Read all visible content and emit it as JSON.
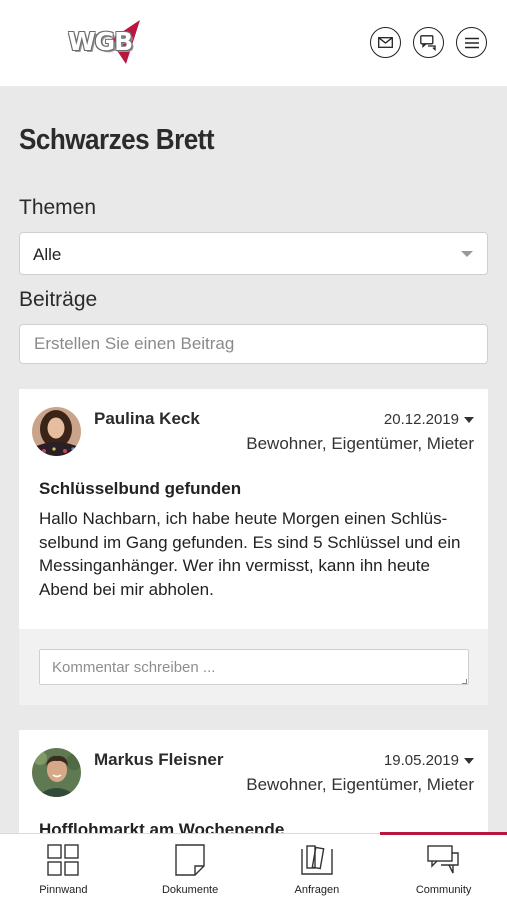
{
  "header": {
    "logo_text": "WGB",
    "brand_color": "#b8153f",
    "icons": [
      "mail-icon",
      "chat-icon",
      "menu-icon"
    ]
  },
  "page": {
    "title": "Schwarzes Brett",
    "topics_label": "Themen",
    "topics_select": {
      "selected": "Alle"
    },
    "posts_label": "Beiträge",
    "create_placeholder": "Erstellen Sie einen Beitrag"
  },
  "posts": [
    {
      "author": "Paulina Keck",
      "date": "20.12.2019",
      "roles": "Bewohner, Eigentümer, Mieter",
      "title": "Schlüsselbund gefunden",
      "body": "Hallo Nachbarn, ich habe heute Morgen einen Schlüs-selbund im Gang gefunden. Es sind 5 Schlüssel und ein Messinganhänger. Wer ihn vermisst, kann ihn heute Abend bei mir abholen.",
      "comment_placeholder": "Kommentar schreiben ..."
    },
    {
      "author": "Markus Fleisner",
      "date": "19.05.2019",
      "roles": "Bewohner, Eigentümer, Mieter",
      "title": "Hofflohmarkt am Wochenende"
    }
  ],
  "bottom_nav": [
    {
      "label": "Pinnwand",
      "icon": "grid-icon",
      "active": false
    },
    {
      "label": "Dokumente",
      "icon": "document-icon",
      "active": false
    },
    {
      "label": "Anfragen",
      "icon": "inquiries-icon",
      "active": false
    },
    {
      "label": "Community",
      "icon": "community-icon",
      "active": true
    }
  ]
}
